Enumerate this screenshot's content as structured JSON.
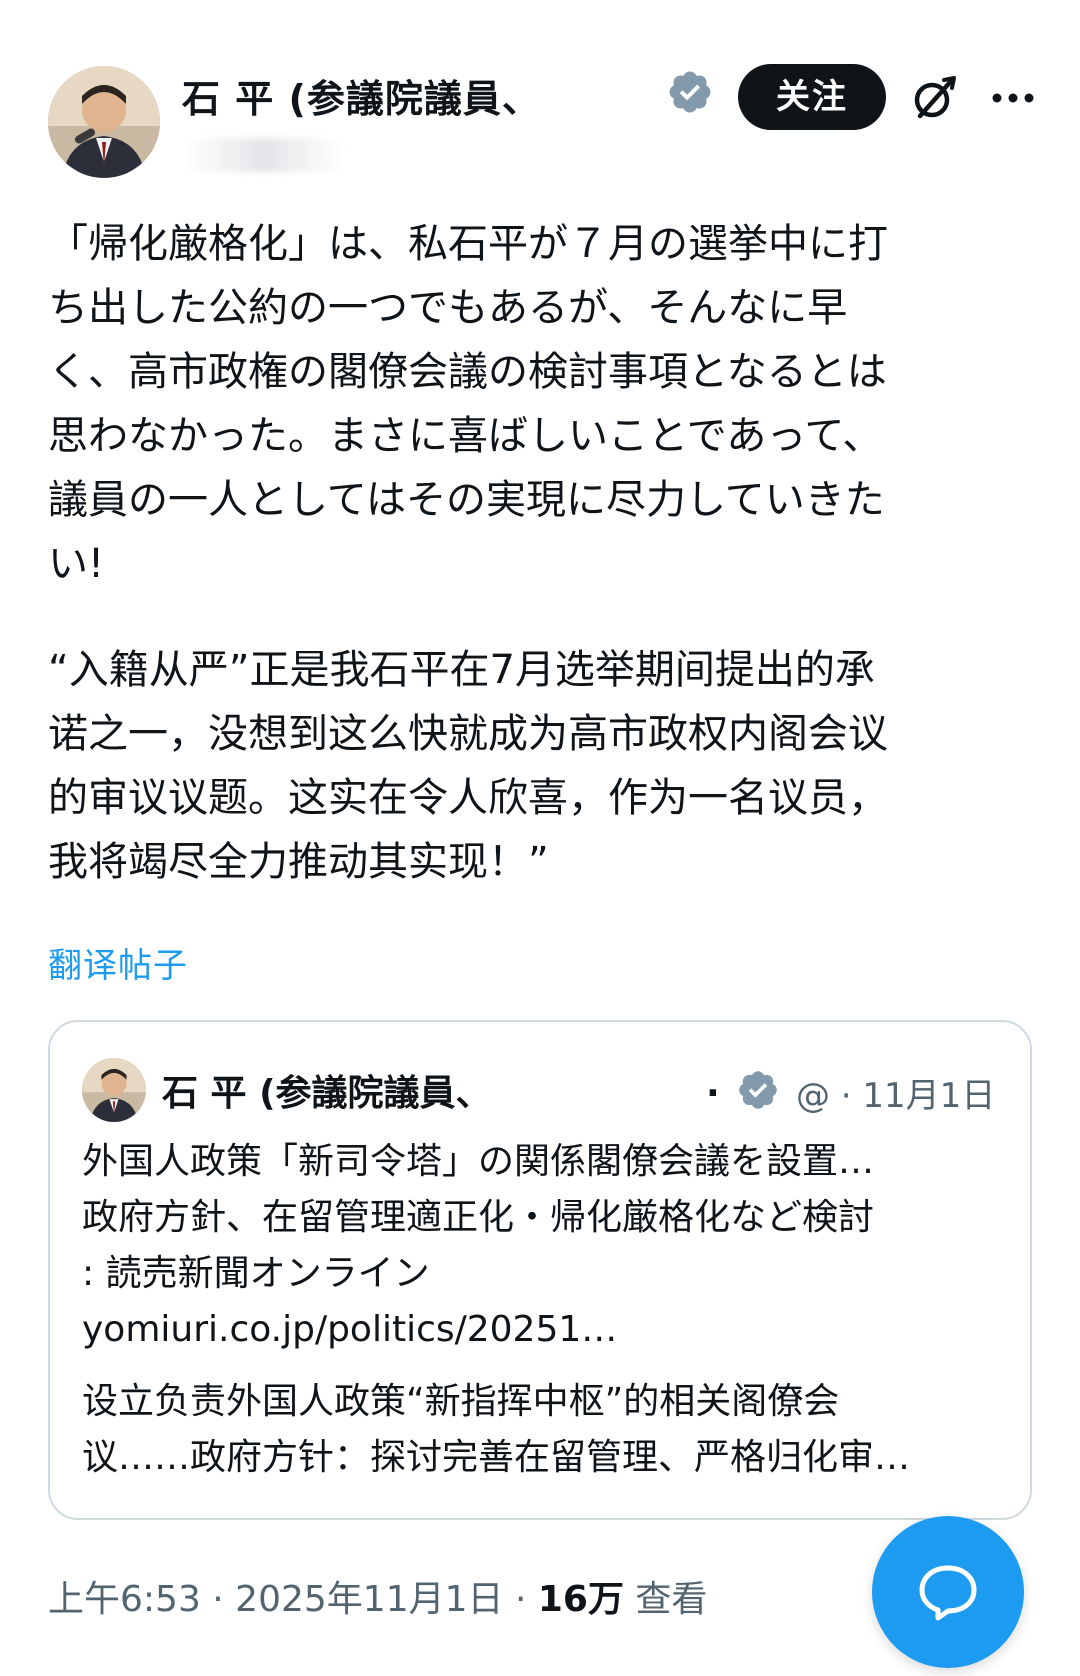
{
  "post": {
    "author": {
      "display_name": "石 平 (参議院議員、",
      "avatar_icon": "avatar-photo",
      "verified_icon": "verified-badge-icon"
    },
    "actions": {
      "follow_label": "关注",
      "grok_icon": "grok-icon",
      "more_icon": "more-icon"
    },
    "text_ja": "「帰化厳格化」は、私石平が７月の選挙中に打\nち出した公約の一つでもあるが、そんなに早\nく、高市政権の閣僚会議の検討事項となるとは\n思わなかった。まさに喜ばしいことであって、\n議員の一人としてはその実現に尽力していきた\nい!",
    "text_zh": "“入籍从严”正是我石平在7月选举期间提出的承\n诺之一，没想到这么快就成为高市政权内阁会议\n的审议议题。这实在令人欣喜，作为一名议员，\n我将竭尽全力推动其实现！”",
    "translate_label": "翻译帖子",
    "quoted": {
      "author_name": "石 平 (参議院議員、",
      "dot": ".",
      "meta": "@ · 11月1日",
      "text": "外国人政策「新司令塔」の関係閣僚会議を設置…\n政府方針、在留管理適正化・帰化厳格化など検討\n: 読売新聞オンライン\nyomiuri.co.jp/politics/20251…",
      "translation": "设立负责外国人政策“新指挥中枢”的相关阁僚会\n议……政府方针：探讨完善在留管理、严格归化审…"
    },
    "footer": {
      "time": "上午6:53 · 2025年11月1日 · ",
      "views_count": "16万",
      "views_label": " 查看"
    },
    "fab_icon": "reply-compose-icon"
  },
  "colors": {
    "accent": "#1d9bf0",
    "text_primary": "#0f1419",
    "text_secondary": "#536471",
    "border": "#cfd9de",
    "verified": "#829aab"
  }
}
